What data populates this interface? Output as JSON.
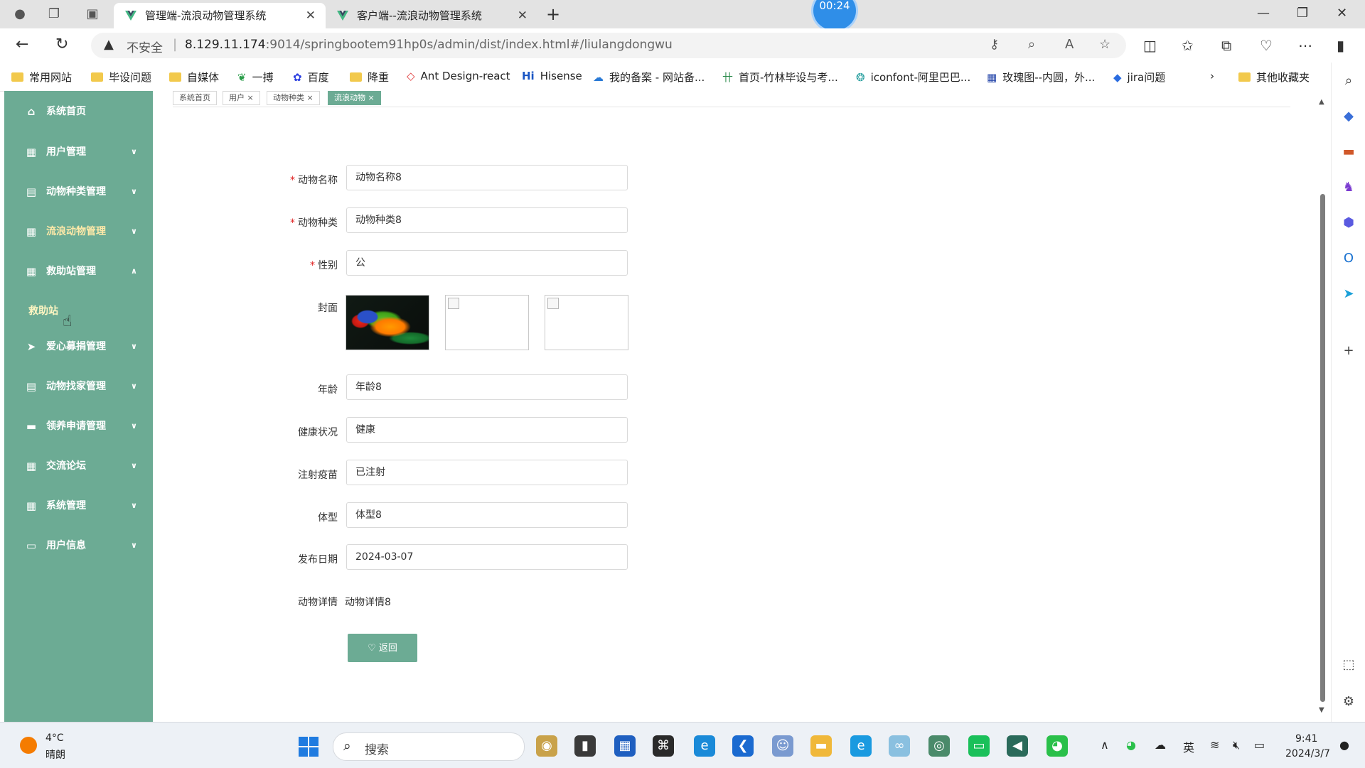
{
  "browser": {
    "tabs": [
      {
        "title": "管理端-流浪动物管理系统",
        "active": true
      },
      {
        "title": "客户端--流浪动物管理系统",
        "active": false
      }
    ],
    "timer": "00:24",
    "address": {
      "insecure_label": "不安全",
      "url_host": "8.129.11.174",
      "url_path": ":9014/springbootem91hp0s/admin/dist/index.html#/liulangdongwu"
    },
    "bookmarks": [
      "常用网站",
      "毕设问题",
      "自媒体",
      "一搏",
      "百度",
      "降重",
      "Ant Design-react",
      "Hisense",
      "我的备案 - 网站备...",
      "首页-竹林毕设与考...",
      "iconfont-阿里巴巴...",
      "玫瑰图--内圆，外...",
      "jira问题"
    ],
    "other_bookmarks": "其他收藏夹"
  },
  "sidebar": {
    "items": [
      {
        "label": "系统首页",
        "icon": "home-icon",
        "chevron": ""
      },
      {
        "label": "用户管理",
        "icon": "grid-icon",
        "chevron": "∨"
      },
      {
        "label": "动物种类管理",
        "icon": "clipboard-icon",
        "chevron": "∨"
      },
      {
        "label": "流浪动物管理",
        "icon": "grid-icon",
        "chevron": "∨"
      },
      {
        "label": "救助站管理",
        "icon": "grid-icon",
        "chevron": "∧"
      },
      {
        "label": "爱心募捐管理",
        "icon": "paper-plane-icon",
        "chevron": "∨"
      },
      {
        "label": "动物找家管理",
        "icon": "clipboard-icon",
        "chevron": "∨"
      },
      {
        "label": "领养申请管理",
        "icon": "comment-icon",
        "chevron": "∨"
      },
      {
        "label": "交流论坛",
        "icon": "grid-icon",
        "chevron": "∨"
      },
      {
        "label": "系统管理",
        "icon": "grid-icon",
        "chevron": "∨"
      },
      {
        "label": "用户信息",
        "icon": "card-icon",
        "chevron": "∨"
      }
    ],
    "submenu": "救助站"
  },
  "breadcrumbs": [
    "系统首页",
    "用户 ×",
    "动物种类 ×",
    "流浪动物 ×"
  ],
  "form": {
    "animal_name": {
      "label": "动物名称",
      "value": "动物名称8",
      "required": "*"
    },
    "animal_type": {
      "label": "动物种类",
      "value": "动物种类8",
      "required": "*"
    },
    "gender": {
      "label": "性别",
      "value": "公",
      "required": "*"
    },
    "cover": {
      "label": "封面"
    },
    "age": {
      "label": "年龄",
      "value": "年龄8"
    },
    "health": {
      "label": "健康状况",
      "value": "健康"
    },
    "vaccine": {
      "label": "注射疫苗",
      "value": "已注射"
    },
    "body_type": {
      "label": "体型",
      "value": "体型8"
    },
    "publish_date": {
      "label": "发布日期",
      "value": "2024-03-07"
    },
    "detail": {
      "label": "动物详情",
      "value": "动物详情8"
    },
    "back_button": "♡ 返回"
  },
  "taskbar": {
    "weather_temp": "4°C",
    "weather_desc": "晴朗",
    "search_placeholder": "搜索",
    "ime": "英",
    "time": "9:41",
    "date": "2024/3/7"
  },
  "colors": {
    "sidebar_bg": "#6cab94",
    "accent": "#6cab94",
    "required": "#e02020"
  }
}
